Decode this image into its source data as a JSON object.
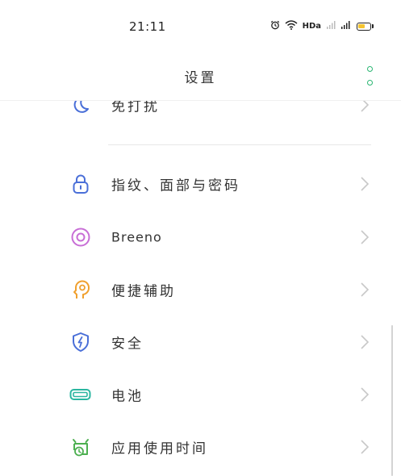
{
  "status_bar": {
    "time": "21:11",
    "network_label": "HDa",
    "icons": [
      "alarm-icon",
      "wifi-icon",
      "hd-icon",
      "signal-icon",
      "signal-icon",
      "battery-icon"
    ]
  },
  "header": {
    "title": "设置",
    "more_icon": "more-vertical-icon"
  },
  "settings": {
    "items": [
      {
        "label": "免打扰",
        "icon": "moon-icon",
        "color": "#4a6fd8"
      },
      {
        "label": "指纹、面部与密码",
        "icon": "lock-icon",
        "color": "#4a6fd8"
      },
      {
        "label": "Breeno",
        "icon": "breeno-icon",
        "color": "#c86ed6"
      },
      {
        "label": "便捷辅助",
        "icon": "assist-icon",
        "color": "#f0a02e"
      },
      {
        "label": "安全",
        "icon": "shield-icon",
        "color": "#4a6fd8"
      },
      {
        "label": "电池",
        "icon": "battery-icon",
        "color": "#2bb6a0"
      },
      {
        "label": "应用使用时间",
        "icon": "app-time-icon",
        "color": "#4caf50"
      }
    ]
  },
  "colors": {
    "accent": "#2bb673",
    "chevron": "#c8c8c8"
  }
}
